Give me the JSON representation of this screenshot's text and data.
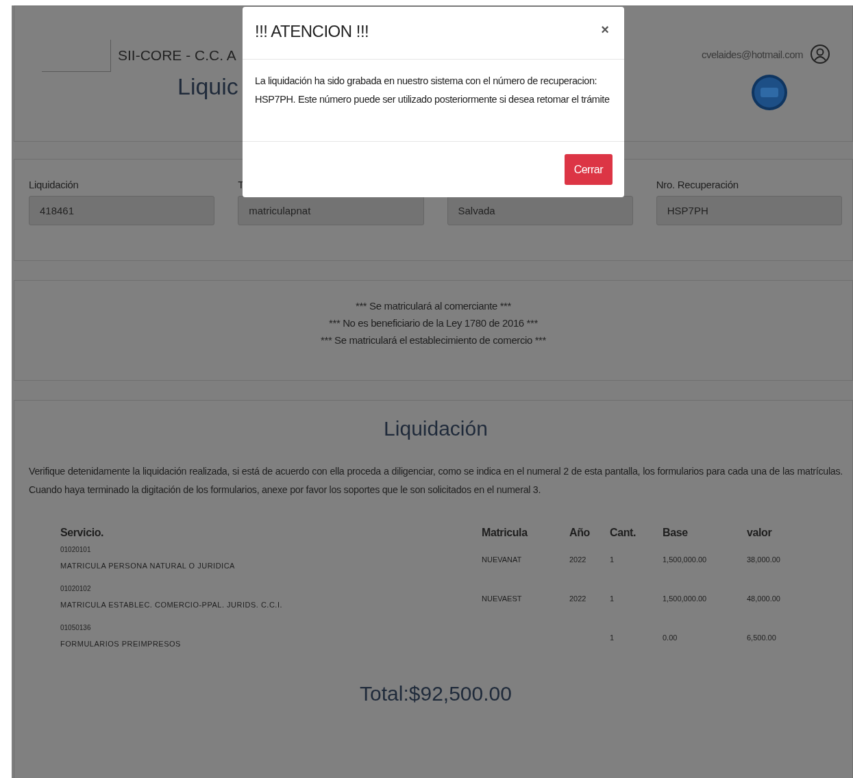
{
  "header": {
    "app_title": "SII-CORE - C.C. A",
    "page_title": "Liquic",
    "user_email": "cvelaides@hotmail.com"
  },
  "fields": [
    {
      "label": "Liquidación",
      "value": "418461"
    },
    {
      "label": "T",
      "value": "matriculapnat"
    },
    {
      "value": "Salvada"
    },
    {
      "label": "Nro. Recuperación",
      "value": "HSP7PH"
    }
  ],
  "notices": [
    "*** Se matriculará al comerciante ***",
    "*** No es beneficiario de la Ley 1780 de 2016 ***",
    "*** Se matriculará el establecimiento de comercio ***"
  ],
  "liquidacion": {
    "title": "Liquidación",
    "instructions": "Verifique detenidamente la liquidación realizada, si está de acuerdo con ella proceda a diligenciar, como se indica en el numeral 2 de esta pantalla, los formularios para cada una de las matrículas. Cuando haya terminado la digitación de los formularios, anexe por favor los soportes que le son solicitados en el numeral 3.",
    "table": {
      "columns": [
        "Servicio.",
        "Matricula",
        "Año",
        "Cant.",
        "Base",
        "valor"
      ],
      "rows": [
        {
          "code": "01020101",
          "name": "MATRICULA PERSONA NATURAL O JURIDICA",
          "matricula": "NUEVANAT",
          "year": "2022",
          "qty": "1",
          "base": "1,500,000.00",
          "value": "38,000.00"
        },
        {
          "code": "01020102",
          "name": "MATRICULA ESTABLEC. COMERCIO-PPAL. JURIDS. C.C.I.",
          "matricula": "NUEVAEST",
          "year": "2022",
          "qty": "1",
          "base": "1,500,000.00",
          "value": "48,000.00"
        },
        {
          "code": "01050136",
          "name": "FORMULARIOS PREIMPRESOS",
          "qty": "1",
          "base": "0.00",
          "value": "6,500.00"
        }
      ]
    },
    "total": "Total:$92,500.00"
  },
  "modal": {
    "title": "!!! ATENCION !!!",
    "close": "×",
    "message": "La liquidación ha sido grabada en nuestro sistema con el número de recuperacion: HSP7PH. Este número puede ser utilizado posteriormente si desea retomar el trámite",
    "button": "Cerrar"
  }
}
